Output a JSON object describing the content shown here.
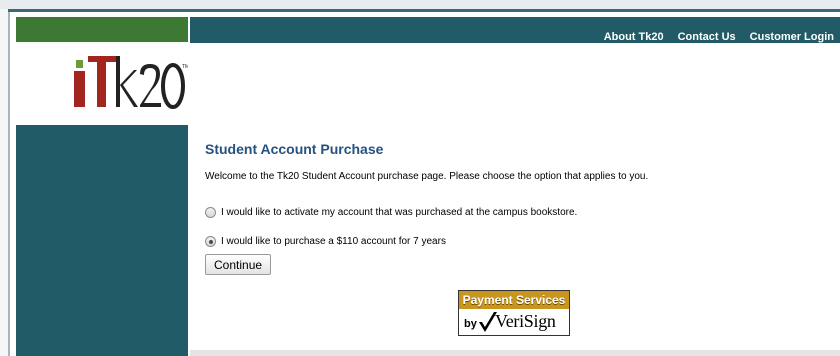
{
  "nav": {
    "items": [
      "About Tk20",
      "Contact Us",
      "Customer Login"
    ]
  },
  "logo": {
    "text": "Tk20",
    "tm": "TM"
  },
  "main": {
    "title": "Student Account Purchase",
    "welcome": "Welcome to the Tk20 Student Account purchase page. Please choose the option that applies to you.",
    "options": [
      {
        "label": "I would like to activate my account that was purchased at the campus bookstore.",
        "checked": false
      },
      {
        "label": "I would like to purchase a $110 account for 7 years",
        "checked": true
      }
    ],
    "continue_label": "Continue"
  },
  "badge": {
    "title": "Payment Services",
    "by": "by",
    "name": "VeriSign"
  },
  "colors": {
    "green": "#3c7a33",
    "teal": "#215b68",
    "title_blue": "#27517e",
    "logo_red": "#a3261e",
    "badge_gold": "#c8961e"
  }
}
